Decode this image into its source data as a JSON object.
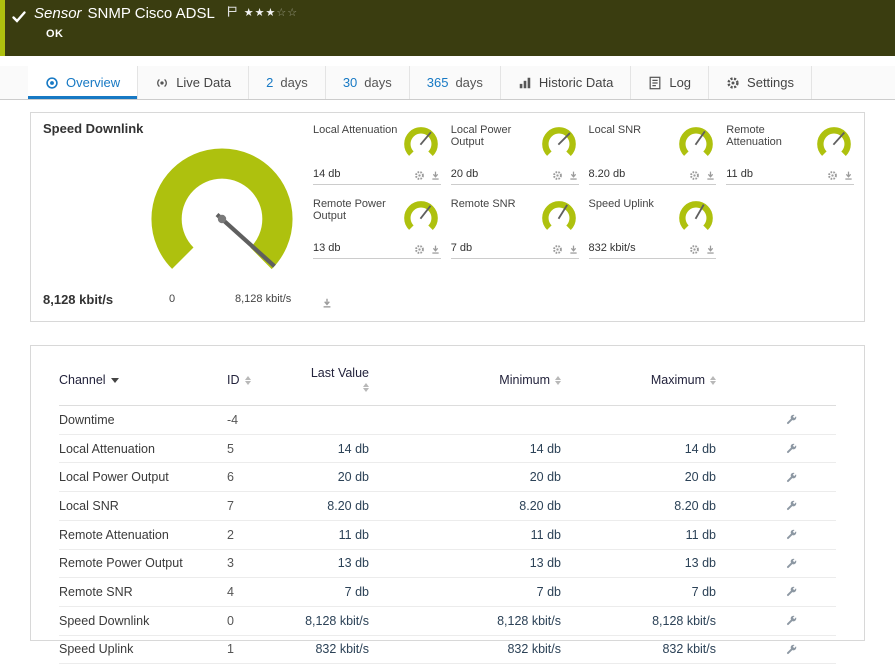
{
  "colors": {
    "header_bg": "#3a3d10",
    "status_green": "#aec10e",
    "gauge_green": "#aec10e",
    "accent_blue": "#1779c4"
  },
  "header": {
    "title_word": "Sensor",
    "title_name": "SNMP Cisco ADSL",
    "status": "OK",
    "stars_filled": "★★★",
    "stars_empty": "☆☆"
  },
  "tabs": [
    {
      "label": "Overview"
    },
    {
      "label": "Live Data"
    },
    {
      "num": "2",
      "label": "days"
    },
    {
      "num": "30",
      "label": "days"
    },
    {
      "num": "365",
      "label": "days"
    },
    {
      "label": "Historic Data"
    },
    {
      "label": "Log"
    },
    {
      "label": "Settings"
    }
  ],
  "gauges": {
    "main": {
      "label": "Speed Downlink",
      "value": "8,128 kbit/s",
      "scale_min": "0",
      "scale_max": "8,128 kbit/s",
      "needle_deg": 132
    },
    "small": [
      {
        "label": "Local Attenuation",
        "value": "14 db",
        "needle_deg": 40
      },
      {
        "label": "Local Power Output",
        "value": "20 db",
        "needle_deg": 45
      },
      {
        "label": "Local SNR",
        "value": "8.20 db",
        "needle_deg": 35
      },
      {
        "label": "Remote Attenuation",
        "value": "11 db",
        "needle_deg": 42
      },
      {
        "label": "Remote Power Output",
        "value": "13 db",
        "needle_deg": 38
      },
      {
        "label": "Remote SNR",
        "value": "7 db",
        "needle_deg": 32
      },
      {
        "label": "Speed Uplink",
        "value": "832 kbit/s",
        "needle_deg": 30
      }
    ]
  },
  "table": {
    "headers": {
      "channel": "Channel",
      "id": "ID",
      "last": "Last Value",
      "min": "Minimum",
      "max": "Maximum"
    },
    "rows": [
      {
        "channel": "Downtime",
        "id": "-4",
        "last": "",
        "min": "",
        "max": ""
      },
      {
        "channel": "Local Attenuation",
        "id": "5",
        "last": "14 db",
        "min": "14 db",
        "max": "14 db"
      },
      {
        "channel": "Local Power Output",
        "id": "6",
        "last": "20 db",
        "min": "20 db",
        "max": "20 db"
      },
      {
        "channel": "Local SNR",
        "id": "7",
        "last": "8.20 db",
        "min": "8.20 db",
        "max": "8.20 db"
      },
      {
        "channel": "Remote Attenuation",
        "id": "2",
        "last": "11 db",
        "min": "11 db",
        "max": "11 db"
      },
      {
        "channel": "Remote Power Output",
        "id": "3",
        "last": "13 db",
        "min": "13 db",
        "max": "13 db"
      },
      {
        "channel": "Remote SNR",
        "id": "4",
        "last": "7 db",
        "min": "7 db",
        "max": "7 db"
      },
      {
        "channel": "Speed Downlink",
        "id": "0",
        "last": "8,128 kbit/s",
        "min": "8,128 kbit/s",
        "max": "8,128 kbit/s"
      },
      {
        "channel": "Speed Uplink",
        "id": "1",
        "last": "832 kbit/s",
        "min": "832 kbit/s",
        "max": "832 kbit/s"
      }
    ]
  }
}
